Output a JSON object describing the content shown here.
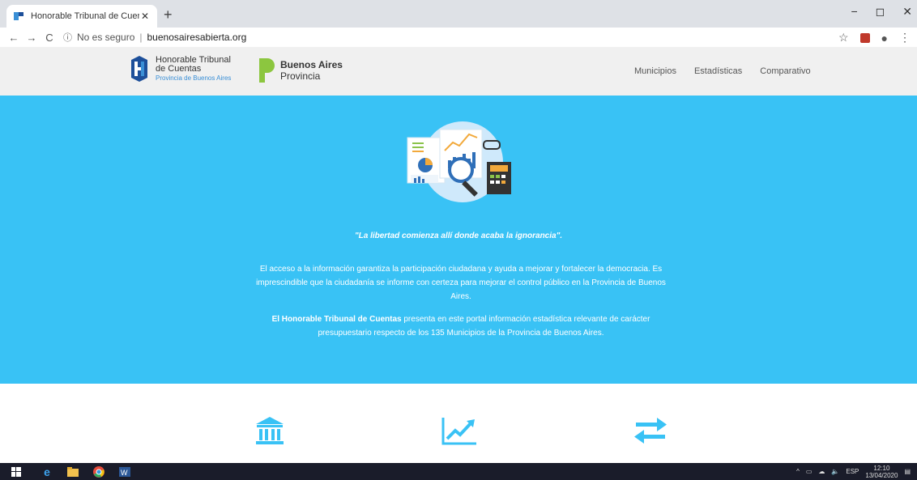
{
  "browser": {
    "tab_title": "Honorable Tribunal de Cuentas d",
    "tab_close": "✕",
    "new_tab": "+",
    "back": "←",
    "forward": "→",
    "reload": "C",
    "security": "No es seguro",
    "url": "buenosairesabierta.org",
    "window_controls": {
      "minimize": "−",
      "maximize": "◻",
      "close": "✕"
    }
  },
  "header": {
    "htc": {
      "line1": "Honorable Tribunal",
      "line2": "de Cuentas",
      "line3": "Provincia de Buenos Aires"
    },
    "ba": {
      "line1": "Buenos Aires",
      "line2": "Provincia"
    },
    "nav": [
      "Municipios",
      "Estadísticas",
      "Comparativo"
    ]
  },
  "hero": {
    "quote": "\"La libertad comienza allí donde acaba la ignorancia\".",
    "paragraph1": "El acceso a la información garantiza la participación ciudadana y ayuda a mejorar y fortalecer la democracia. Es imprescindible que la ciudadanía se informe con certeza para mejorar el control público en la Provincia de Buenos Aires.",
    "paragraph2_bold": "El Honorable Tribunal de Cuentas",
    "paragraph2_rest": " presenta en este portal información estadística relevante de carácter presupuestario respecto de los 135 Municipios de la Provincia de Buenos Aires."
  },
  "features": [
    {
      "icon": "institution-icon"
    },
    {
      "icon": "trend-chart-icon"
    },
    {
      "icon": "exchange-arrows-icon"
    }
  ],
  "taskbar": {
    "lang": "ESP",
    "time": "12:10",
    "date": "13/04/2020"
  },
  "colors": {
    "accent": "#39c2f5",
    "htc_blue": "#3a8fd6",
    "ba_green": "#8cc63f"
  }
}
